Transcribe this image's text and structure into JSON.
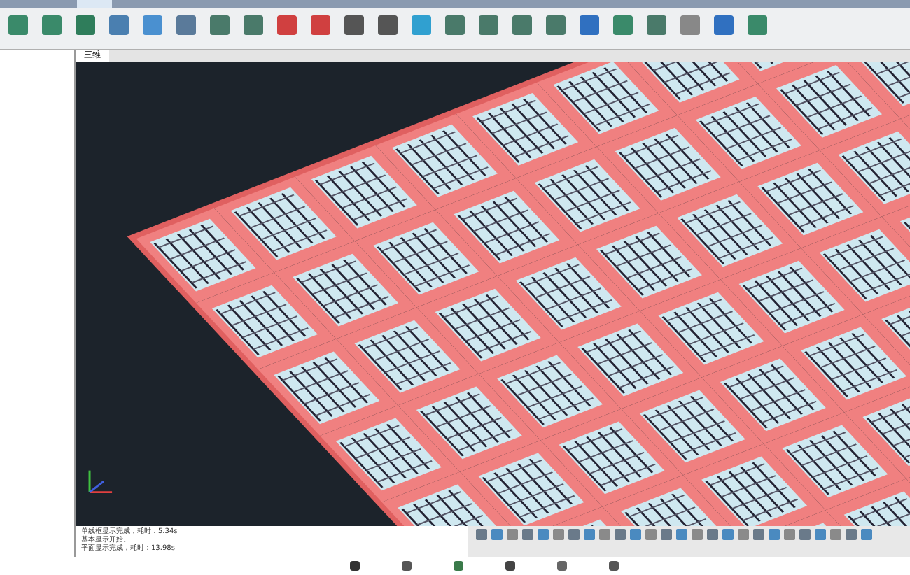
{
  "document_tabs": [
    {
      "label": "三维",
      "selected": true
    }
  ],
  "output_lines": [
    "单线框显示完成，耗时：5.34s",
    "基本显示开始。",
    "平面显示完成，耗时：13.98s"
  ]
}
